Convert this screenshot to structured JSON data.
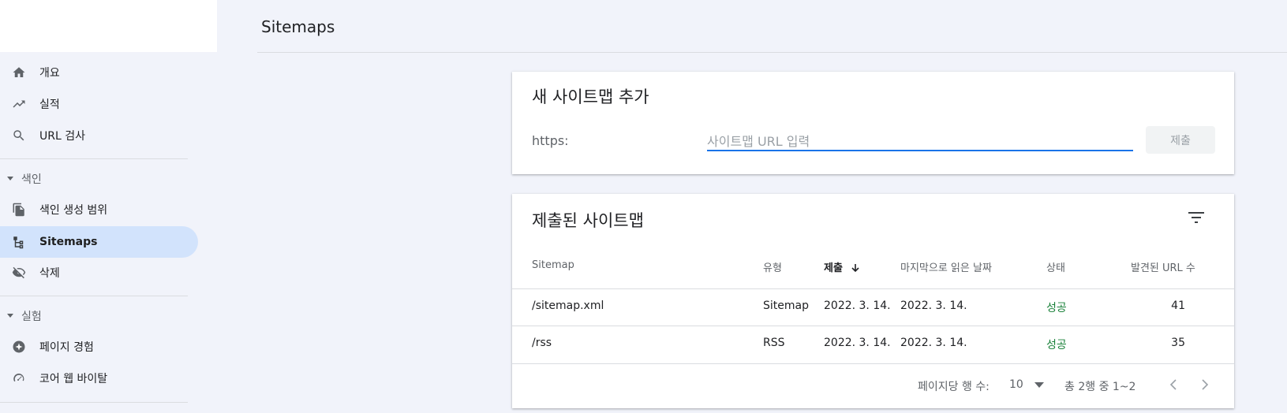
{
  "page": {
    "title": "Sitemaps"
  },
  "sidebar": {
    "items": [
      {
        "label": "개요",
        "icon": "home-icon"
      },
      {
        "label": "실적",
        "icon": "trending-up-icon"
      },
      {
        "label": "URL 검사",
        "icon": "search-icon"
      }
    ],
    "sections": [
      {
        "label": "색인",
        "items": [
          {
            "label": "색인 생성 범위",
            "icon": "copy-icon"
          },
          {
            "label": "Sitemaps",
            "icon": "sitemap-icon",
            "active": true
          },
          {
            "label": "삭제",
            "icon": "visibility-off-icon"
          }
        ]
      },
      {
        "label": "실험",
        "items": [
          {
            "label": "페이지 경험",
            "icon": "experience-icon"
          },
          {
            "label": "코어 웹 바이탈",
            "icon": "speed-gauge-icon"
          }
        ]
      }
    ]
  },
  "add_card": {
    "title": "새 사이트맵 추가",
    "prefix": "https:",
    "input_placeholder": "사이트맵 URL 입력",
    "input_value": "",
    "submit_label": "제출"
  },
  "submitted_card": {
    "title": "제출된 사이트맵",
    "columns": [
      "Sitemap",
      "유형",
      "제출",
      "마지막으로 읽은 날짜",
      "상태",
      "발견된 URL 수"
    ],
    "rows": [
      {
        "sitemap": "/sitemap.xml",
        "type": "Sitemap",
        "submitted": "2022. 3. 14.",
        "last_read": "2022. 3. 14.",
        "status": "성공",
        "urls": "41"
      },
      {
        "sitemap": "/rss",
        "type": "RSS",
        "submitted": "2022. 3. 14.",
        "last_read": "2022. 3. 14.",
        "status": "성공",
        "urls": "35"
      }
    ],
    "footer": {
      "rows_per_page_label": "페이지당 행 수:",
      "rows_per_page_value": "10",
      "range_text": "총 2행 중 1~2"
    }
  },
  "colors": {
    "accent": "#1a73e8",
    "active_nav_bg": "#d2e3fc",
    "success": "#188038",
    "background": "#f1f3fa"
  }
}
